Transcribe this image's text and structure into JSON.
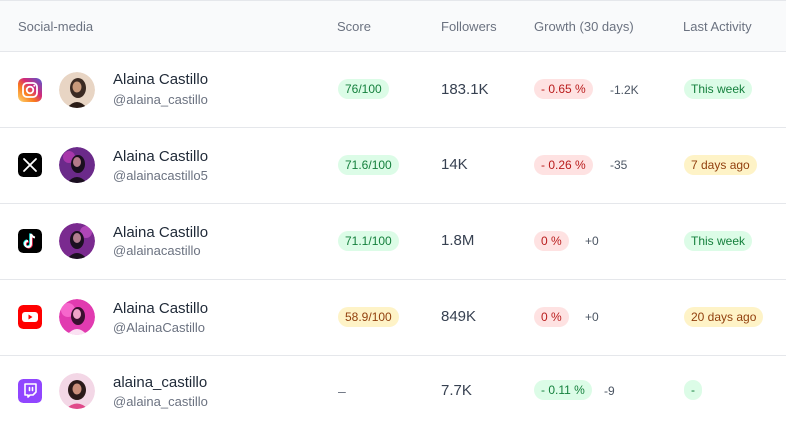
{
  "header": {
    "social_media": "Social-media",
    "score": "Score",
    "followers": "Followers",
    "growth": "Growth (30 days)",
    "last_activity": "Last Activity"
  },
  "rows": [
    {
      "platform": "instagram",
      "name": "Alaina Castillo",
      "handle": "@alaina_castillo",
      "score": "76/100",
      "followers": "183.1K",
      "growth": "- 0.65 %",
      "delta": "-1.2K",
      "last_activity": "This week"
    },
    {
      "platform": "x",
      "name": "Alaina Castillo",
      "handle": "@alainacastillo5",
      "score": "71.6/100",
      "followers": "14K",
      "growth": "- 0.26 %",
      "delta": "-35",
      "last_activity": "7 days ago"
    },
    {
      "platform": "tiktok",
      "name": "Alaina Castillo",
      "handle": "@alainacastillo",
      "score": "71.1/100",
      "followers": "1.8M",
      "growth": "0 %",
      "delta": "+0",
      "last_activity": "This week"
    },
    {
      "platform": "youtube",
      "name": "Alaina Castillo",
      "handle": "@AlainaCastillo",
      "score": "58.9/100",
      "followers": "849K",
      "growth": "0 %",
      "delta": "+0",
      "last_activity": "20 days ago"
    },
    {
      "platform": "twitch",
      "name": "alaina_castillo",
      "handle": "@alaina_castillo",
      "score": "–",
      "followers": "7.7K",
      "growth": "- 0.11 %",
      "delta": "-9",
      "last_activity": "-"
    }
  ],
  "colors": {
    "green_bg": "#dcfce7",
    "green_text": "#15803d",
    "amber_bg": "#fef3c7",
    "amber_text": "#92400e",
    "red_bg": "#fee2e2",
    "red_text": "#b91c1c"
  }
}
